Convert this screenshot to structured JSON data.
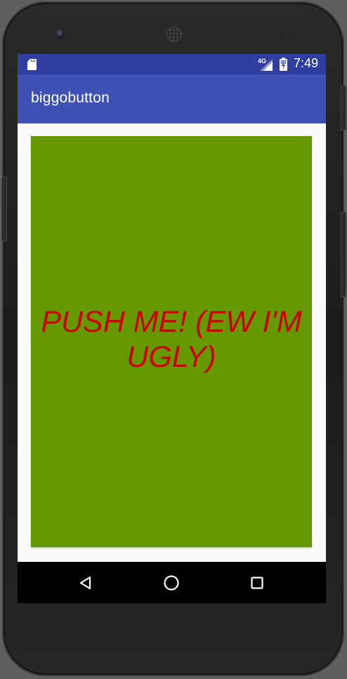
{
  "status_bar": {
    "network_type": "4G",
    "time": "7:49",
    "background_color": "#303f9f",
    "icons": [
      "sd-card-icon",
      "signal-icon",
      "battery-charging-icon"
    ]
  },
  "action_bar": {
    "title": "biggobutton",
    "background_color": "#3f51b5"
  },
  "main": {
    "button": {
      "label": "PUSH ME! (EW I'M UGLY)",
      "background_color": "#669900",
      "text_color": "#cc0000"
    }
  },
  "nav_bar": {
    "buttons": [
      {
        "name": "back",
        "icon": "back-triangle-icon"
      },
      {
        "name": "home",
        "icon": "home-circle-icon"
      },
      {
        "name": "recents",
        "icon": "recents-square-icon"
      }
    ]
  }
}
